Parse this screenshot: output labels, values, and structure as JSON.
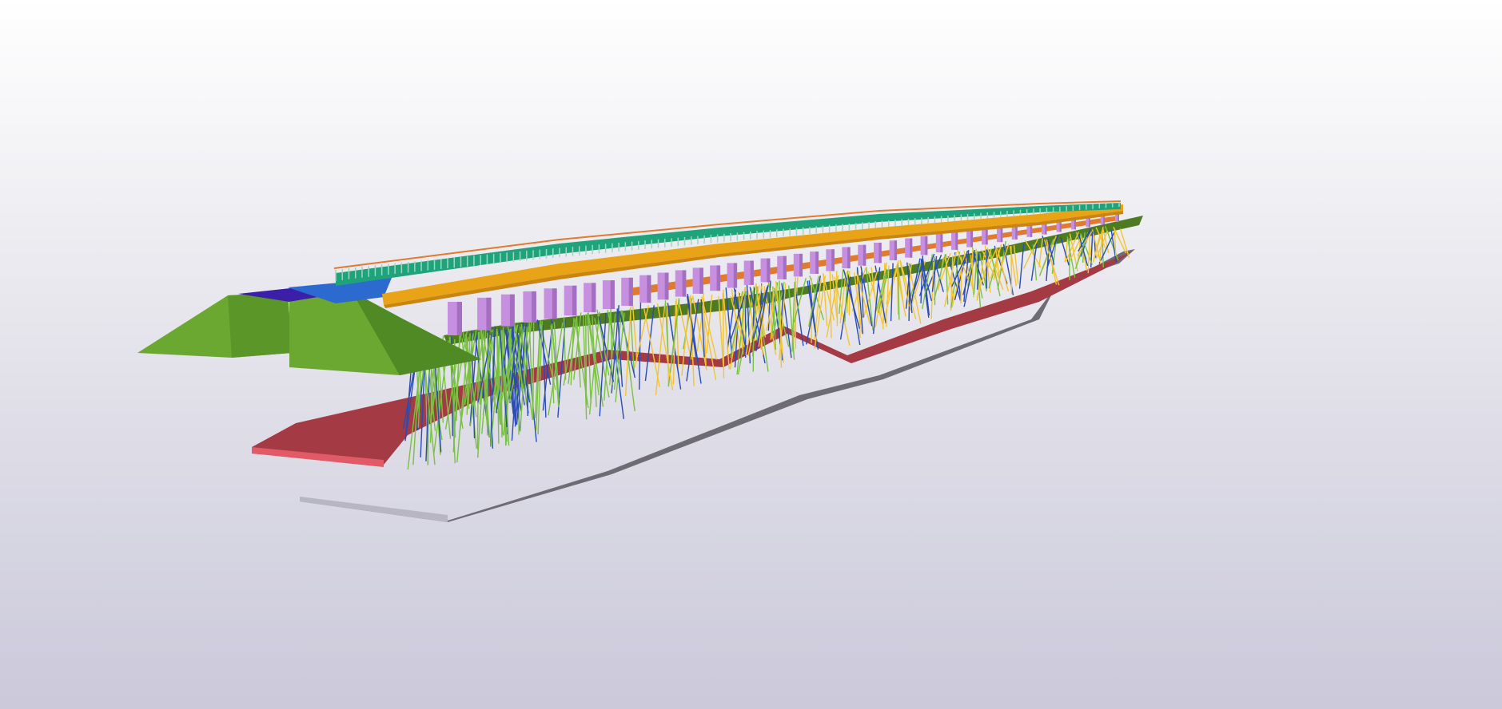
{
  "viewport": {
    "background_top": "#ffffff",
    "background_bottom": "#cbc9da"
  },
  "model": {
    "colors": {
      "embankment": "#6aa832",
      "embankment_dark": "#4f8a24",
      "ground_layer": "#a33a44",
      "ground_layer_edge": "#e05a68",
      "bedrock_layer": "#6e6b75",
      "bedrock_edge": "#b9b6c4",
      "pile_cap_layer": "#4e7a22",
      "pier": "#c78fe0",
      "pier_shade": "#a46fc0",
      "girder": "#e8a317",
      "girder_dark": "#c98510",
      "deck": "#1fa37a",
      "railing": "#9fd6c0",
      "pile_green": "#7ac142",
      "pile_blue": "#2a4bb5",
      "pile_yellow": "#f2c530",
      "abutment_blue": "#3b1fa8",
      "orange_beam": "#e07a2f"
    },
    "pier_count": 40,
    "icons": [
      "bridge-model-icon"
    ]
  }
}
